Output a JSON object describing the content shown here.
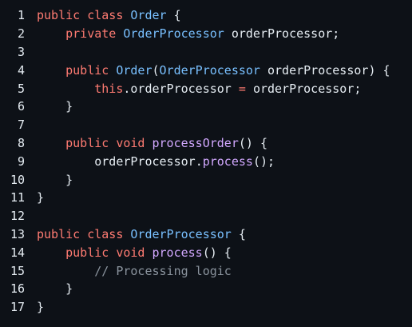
{
  "editor": {
    "language": "java",
    "theme": {
      "background": "#0d1117",
      "keyword": "#ff7b72",
      "type": "#79c0ff",
      "function": "#d2a8ff",
      "text": "#e6edf3",
      "comment": "#8b949e"
    },
    "lines": [
      {
        "number": "1",
        "indent": "",
        "tokens": [
          [
            "kw",
            "public"
          ],
          [
            "punc",
            " "
          ],
          [
            "kw",
            "class"
          ],
          [
            "punc",
            " "
          ],
          [
            "type",
            "Order"
          ],
          [
            "punc",
            " {"
          ]
        ]
      },
      {
        "number": "2",
        "indent": "    ",
        "tokens": [
          [
            "kw",
            "private"
          ],
          [
            "punc",
            " "
          ],
          [
            "type",
            "OrderProcessor"
          ],
          [
            "punc",
            " "
          ],
          [
            "var",
            "orderProcessor"
          ],
          [
            "punc",
            ";"
          ]
        ]
      },
      {
        "number": "3",
        "indent": "",
        "tokens": []
      },
      {
        "number": "4",
        "indent": "    ",
        "tokens": [
          [
            "kw",
            "public"
          ],
          [
            "punc",
            " "
          ],
          [
            "type",
            "Order"
          ],
          [
            "punc",
            "("
          ],
          [
            "type",
            "OrderProcessor"
          ],
          [
            "punc",
            " "
          ],
          [
            "var",
            "orderProcessor"
          ],
          [
            "punc",
            ") {"
          ]
        ]
      },
      {
        "number": "5",
        "indent": "        ",
        "tokens": [
          [
            "kw",
            "this"
          ],
          [
            "punc",
            "."
          ],
          [
            "var",
            "orderProcessor"
          ],
          [
            "punc",
            " "
          ],
          [
            "op",
            "="
          ],
          [
            "punc",
            " "
          ],
          [
            "var",
            "orderProcessor"
          ],
          [
            "punc",
            ";"
          ]
        ]
      },
      {
        "number": "6",
        "indent": "    ",
        "tokens": [
          [
            "punc",
            "}"
          ]
        ]
      },
      {
        "number": "7",
        "indent": "",
        "tokens": []
      },
      {
        "number": "8",
        "indent": "    ",
        "tokens": [
          [
            "kw",
            "public"
          ],
          [
            "punc",
            " "
          ],
          [
            "kw",
            "void"
          ],
          [
            "punc",
            " "
          ],
          [
            "fn",
            "processOrder"
          ],
          [
            "punc",
            "() {"
          ]
        ]
      },
      {
        "number": "9",
        "indent": "        ",
        "tokens": [
          [
            "var",
            "orderProcessor"
          ],
          [
            "punc",
            "."
          ],
          [
            "fn",
            "process"
          ],
          [
            "punc",
            "();"
          ]
        ]
      },
      {
        "number": "10",
        "indent": "    ",
        "tokens": [
          [
            "punc",
            "}"
          ]
        ]
      },
      {
        "number": "11",
        "indent": "",
        "tokens": [
          [
            "punc",
            "}"
          ]
        ]
      },
      {
        "number": "12",
        "indent": "",
        "tokens": []
      },
      {
        "number": "13",
        "indent": "",
        "tokens": [
          [
            "kw",
            "public"
          ],
          [
            "punc",
            " "
          ],
          [
            "kw",
            "class"
          ],
          [
            "punc",
            " "
          ],
          [
            "type",
            "OrderProcessor"
          ],
          [
            "punc",
            " {"
          ]
        ]
      },
      {
        "number": "14",
        "indent": "    ",
        "tokens": [
          [
            "kw",
            "public"
          ],
          [
            "punc",
            " "
          ],
          [
            "kw",
            "void"
          ],
          [
            "punc",
            " "
          ],
          [
            "fn",
            "process"
          ],
          [
            "punc",
            "() {"
          ]
        ]
      },
      {
        "number": "15",
        "indent": "        ",
        "tokens": [
          [
            "comment",
            "// Processing logic"
          ]
        ]
      },
      {
        "number": "16",
        "indent": "    ",
        "tokens": [
          [
            "punc",
            "}"
          ]
        ]
      },
      {
        "number": "17",
        "indent": "",
        "tokens": [
          [
            "punc",
            "}"
          ]
        ]
      }
    ]
  }
}
